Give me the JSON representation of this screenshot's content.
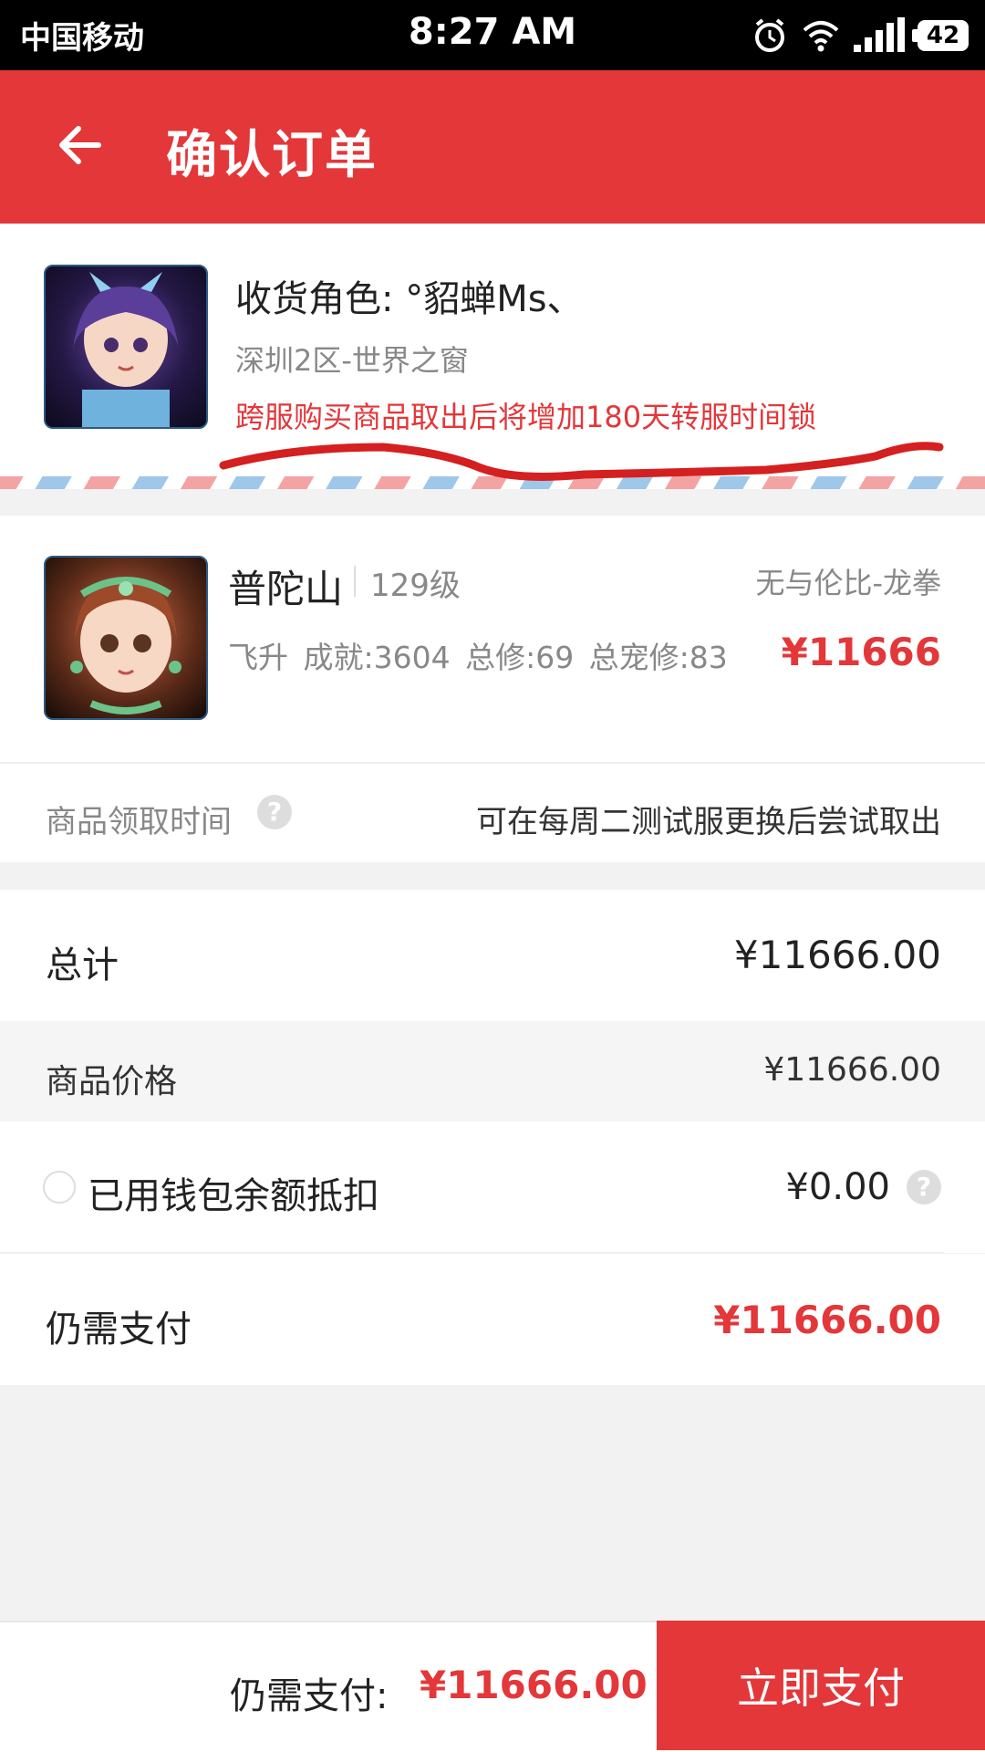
{
  "status_bar": {
    "carrier": "中国移动",
    "time": "8:27 AM",
    "battery": "42"
  },
  "header": {
    "title": "确认订单"
  },
  "recipient": {
    "title": "收货角色: °貂蝉Ms、",
    "server": "深圳2区-世界之窗",
    "warning": "跨服购买商品取出后将增加180天转服时间锁"
  },
  "character": {
    "school": "普陀山",
    "level": "129级",
    "tag": "无与伦比-龙拳",
    "stats": "飞升  成就:3604  总修:69  总宠修:83",
    "price": "¥11666"
  },
  "pickup": {
    "label": "商品领取时间",
    "help": "?",
    "value": "可在每周二测试服更换后尝试取出"
  },
  "summary": {
    "total_label": "总计",
    "total_value": "¥11666.00",
    "price_label": "商品价格",
    "price_value": "¥11666.00",
    "wallet_label": "已用钱包余额抵扣",
    "wallet_value": "¥0.00",
    "wallet_help": "?",
    "due_label": "仍需支付",
    "due_value": "¥11666.00"
  },
  "bottom_bar": {
    "label": "仍需支付:",
    "value": "¥11666.00",
    "pay_button": "立即支付"
  },
  "colors": {
    "brand_red": "#e3373a",
    "background": "#f2f2f2"
  },
  "icons": {
    "back": "arrow-left-icon",
    "help": "question-circle-icon",
    "alarm": "alarm-icon",
    "wifi": "wifi-icon",
    "signal": "signal-icon",
    "battery": "battery-icon"
  }
}
